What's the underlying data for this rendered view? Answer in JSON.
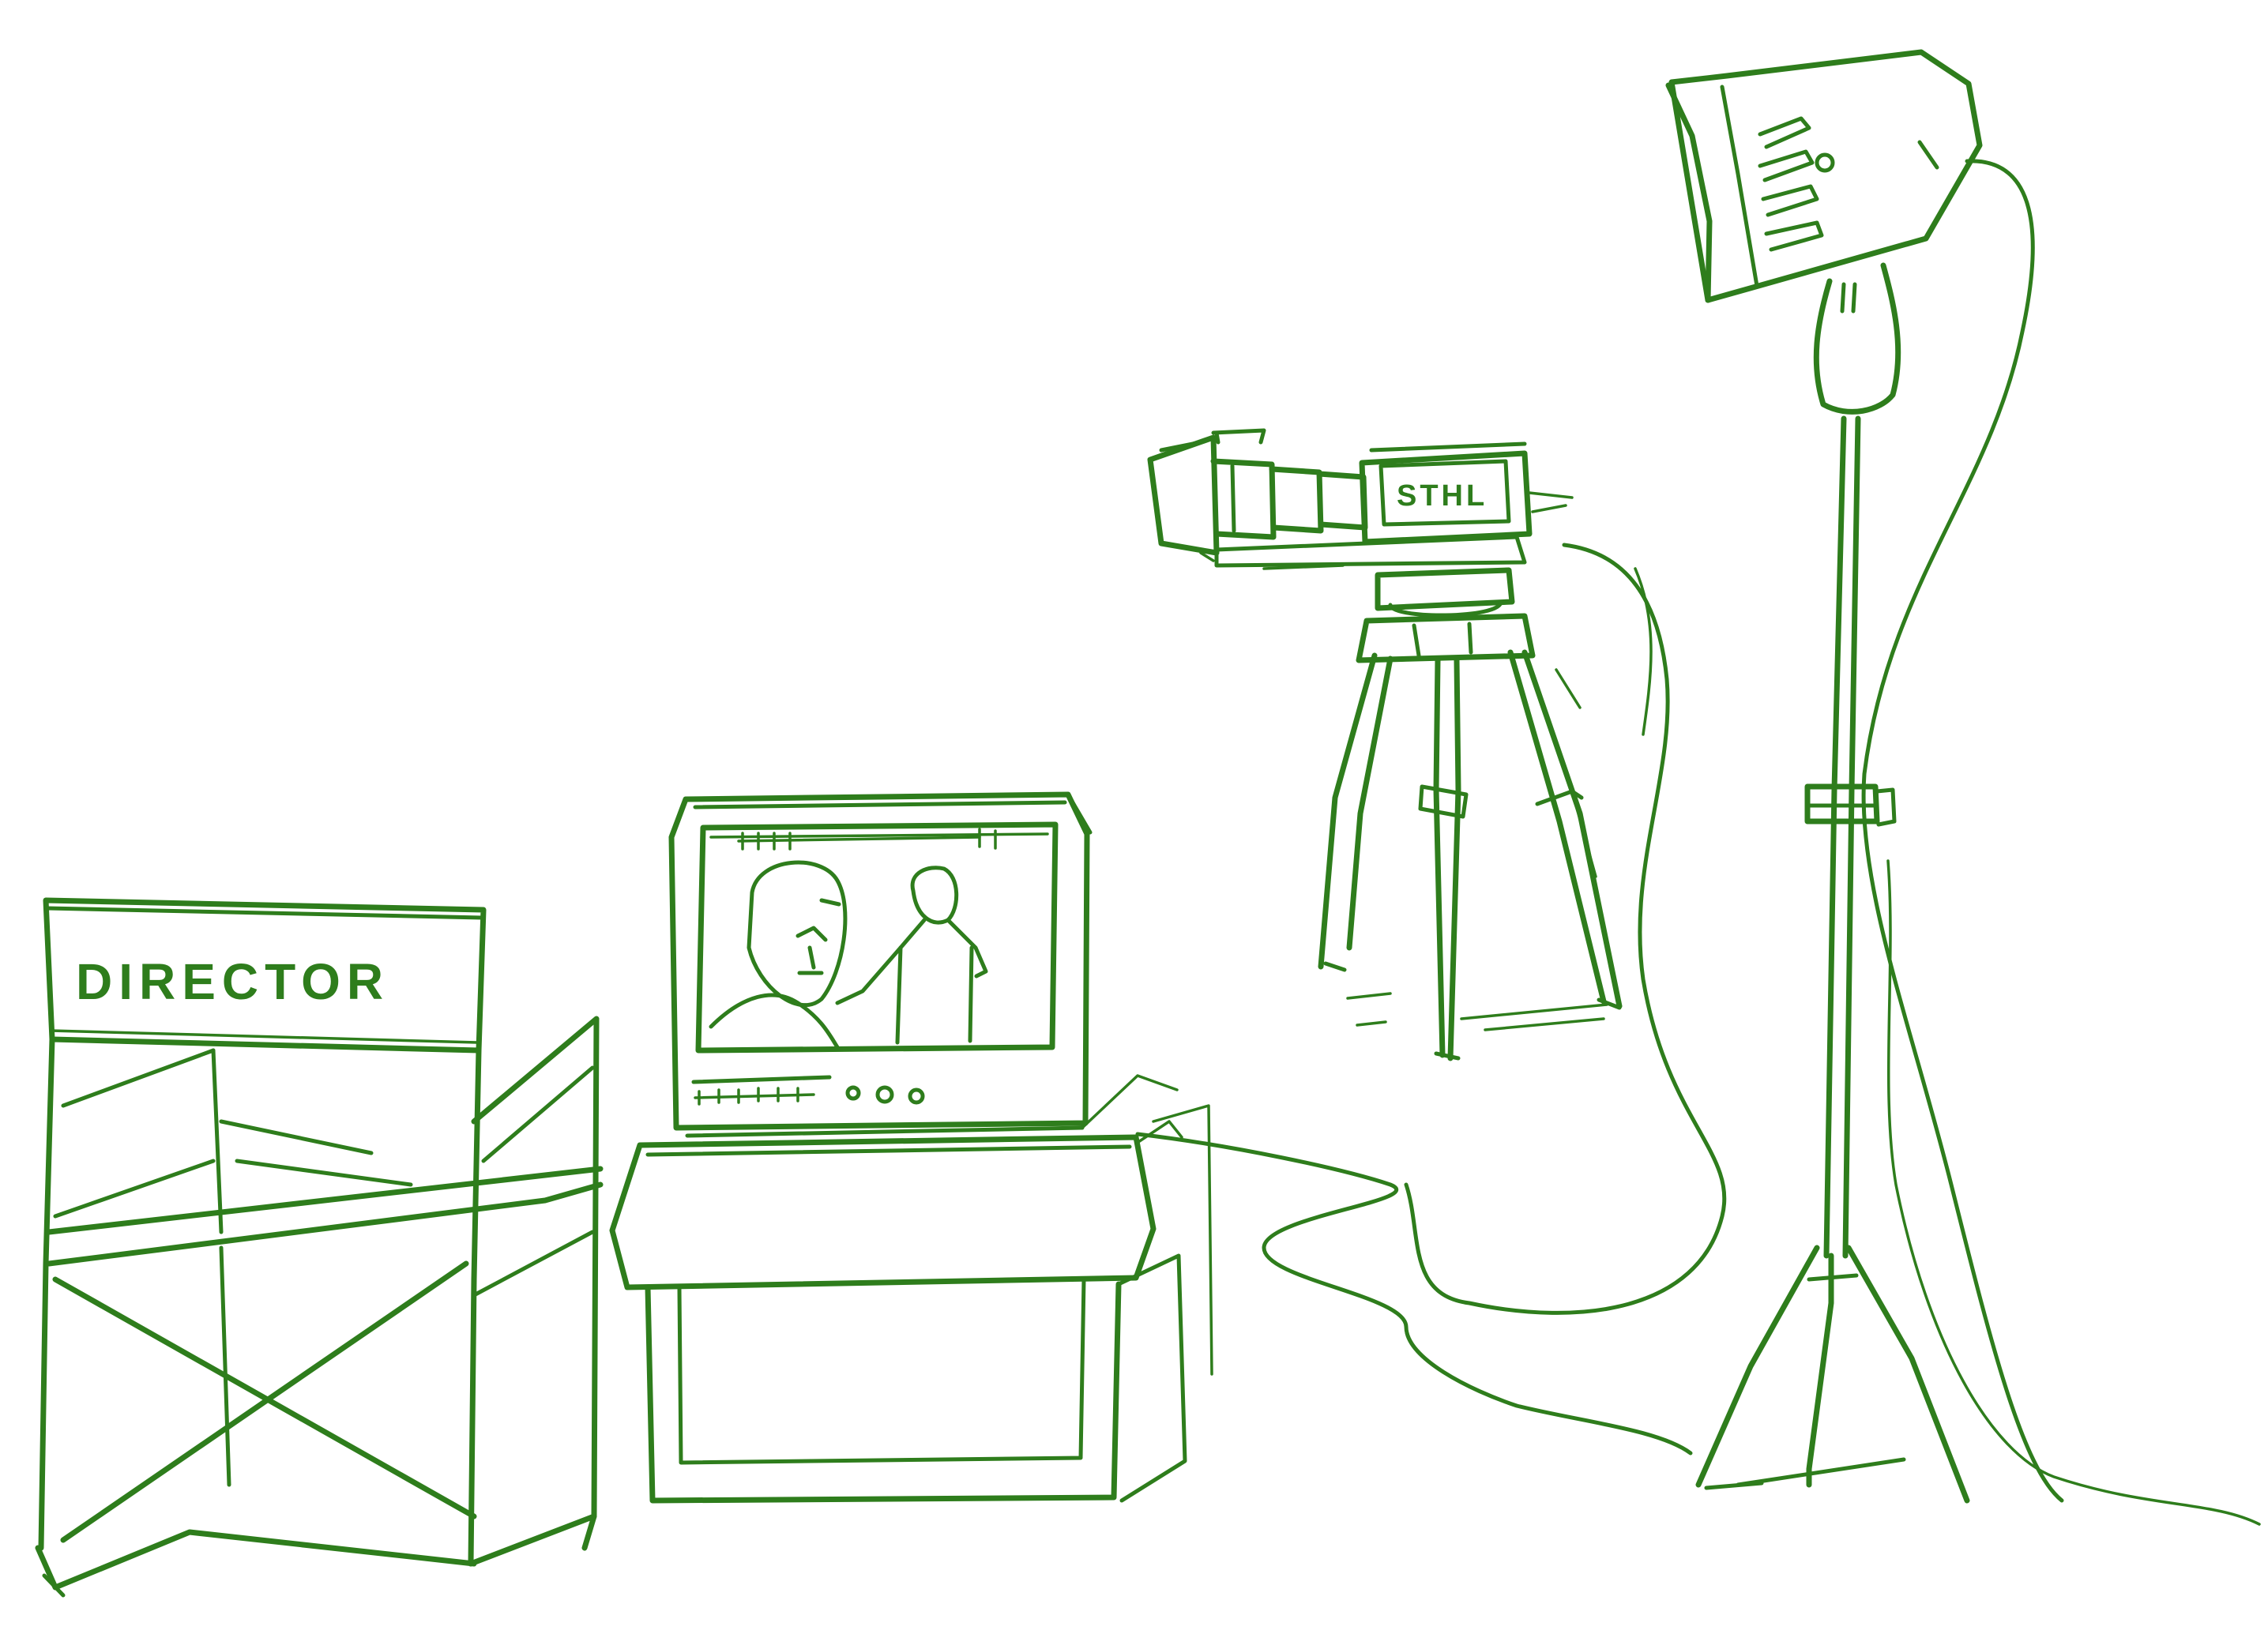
{
  "drawing": {
    "chair_label": "DIRECTOR",
    "camera_label": "STHL",
    "ink_color": "#2e7d1c",
    "background_color": "#ffffff",
    "objects": [
      "director-chair",
      "monitor",
      "monitor-stand",
      "video-camera",
      "tripod",
      "studio-light",
      "light-stand",
      "cable"
    ]
  }
}
